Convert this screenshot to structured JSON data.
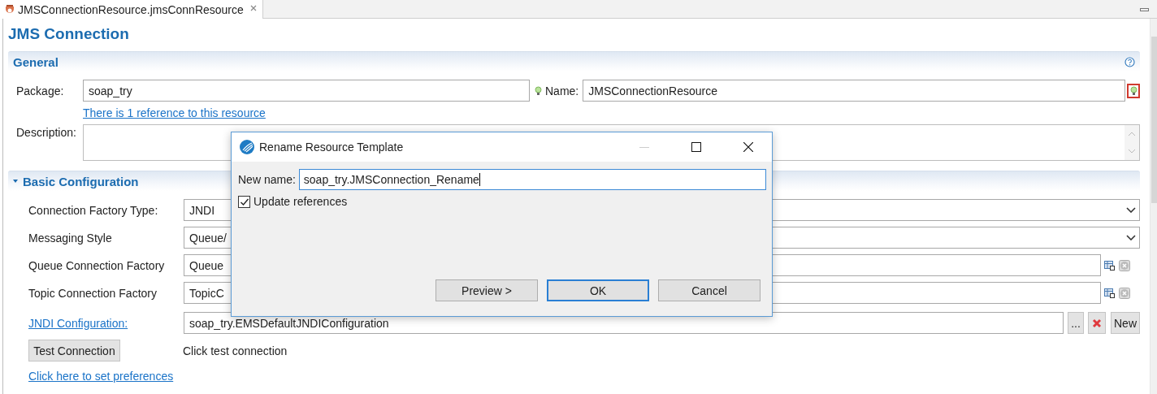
{
  "tab": {
    "title": "JMSConnectionResource.jmsConnResource",
    "selected": true
  },
  "heading": "JMS Connection",
  "general": {
    "title": "General",
    "package": {
      "label": "Package:",
      "value": "soap_try"
    },
    "name": {
      "label": "Name:",
      "value": "JMSConnectionResource"
    },
    "reference_link": "There is 1 reference to this resource",
    "description": {
      "label": "Description:"
    }
  },
  "basic_configuration": {
    "title": "Basic Configuration",
    "expanded": true,
    "rows": [
      {
        "kind": "select",
        "label": "Connection Factory Type:",
        "value": "JNDI"
      },
      {
        "kind": "select",
        "label": "Messaging Style",
        "value": "Queue/"
      },
      {
        "kind": "picker",
        "label": "Queue Connection Factory",
        "value": "Queue"
      },
      {
        "kind": "picker",
        "label": "Topic Connection Factory",
        "value": "TopicC"
      },
      {
        "kind": "reference",
        "label": "JNDI Configuration:",
        "value": "soap_try.EMSDefaultJNDIConfiguration",
        "browse_button": "...",
        "new_button": "New"
      }
    ],
    "test_button": "Test Connection",
    "test_status": "Click test connection",
    "preferences_link": "Click here to set preferences"
  },
  "dialog": {
    "title": "Rename Resource Template",
    "new_name": {
      "label": "New name:",
      "value": "soap_try.JMSConnection_Rename"
    },
    "update_references": {
      "label": "Update references",
      "checked": true
    },
    "buttons": [
      {
        "label": "Preview >",
        "default": false
      },
      {
        "label": "OK",
        "default": true
      },
      {
        "label": "Cancel",
        "default": false
      }
    ]
  }
}
